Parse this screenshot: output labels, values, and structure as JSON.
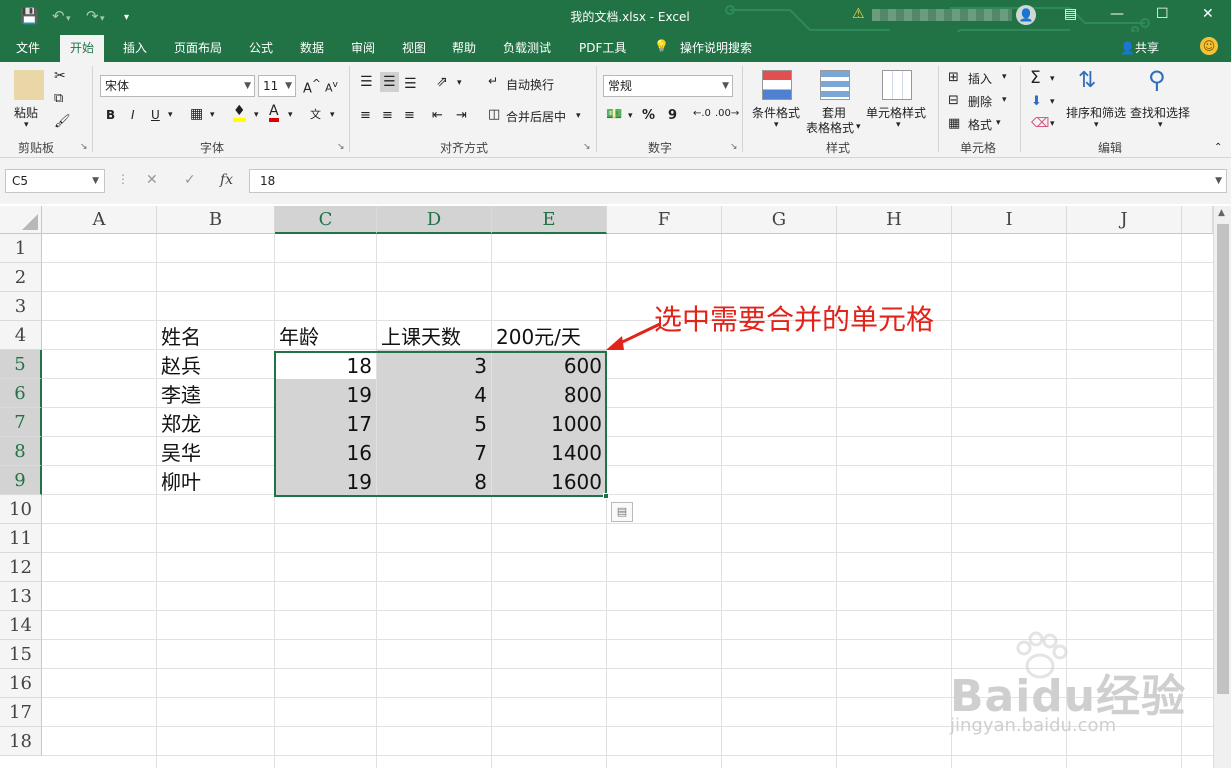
{
  "window": {
    "doc_title": "我的文档.xlsx  -  Excel",
    "user_avatar": "👤"
  },
  "tabs": [
    {
      "label": "文件"
    },
    {
      "label": "开始"
    },
    {
      "label": "插入"
    },
    {
      "label": "页面布局"
    },
    {
      "label": "公式"
    },
    {
      "label": "数据"
    },
    {
      "label": "审阅"
    },
    {
      "label": "视图"
    },
    {
      "label": "帮助"
    },
    {
      "label": "负载测试"
    },
    {
      "label": "PDF工具"
    },
    {
      "label": "操作说明搜索"
    }
  ],
  "share_label": "共享",
  "ribbon": {
    "clipboard": {
      "paste_label": "粘贴",
      "group_label": "剪贴板"
    },
    "font": {
      "font_name": "宋体",
      "font_size": "11",
      "group_label": "字体",
      "bold": "B",
      "italic": "I",
      "underline": "U"
    },
    "alignment": {
      "wrap_label": "自动换行",
      "merge_label": "合并后居中",
      "group_label": "对齐方式"
    },
    "number": {
      "format": "常规",
      "percent": "%",
      "comma": "9",
      "group_label": "数字"
    },
    "styles": {
      "cond_format": "条件格式",
      "table_format_1": "套用",
      "table_format_2": "表格格式",
      "cell_styles": "单元格样式",
      "group_label": "样式"
    },
    "cells": {
      "insert": "插入",
      "delete": "删除",
      "format": "格式",
      "group_label": "单元格"
    },
    "editing": {
      "sort_filter": "排序和筛选",
      "find_select": "查找和选择",
      "group_label": "编辑"
    }
  },
  "formula_bar": {
    "name_box": "C5",
    "formula": "18"
  },
  "columns": [
    "A",
    "B",
    "C",
    "D",
    "E",
    "F",
    "G",
    "H",
    "I",
    "J"
  ],
  "selected_columns": [
    "C",
    "D",
    "E"
  ],
  "rows": [
    "1",
    "2",
    "3",
    "4",
    "5",
    "6",
    "7",
    "8",
    "9",
    "10",
    "11",
    "12",
    "13",
    "14",
    "15",
    "16",
    "17",
    "18"
  ],
  "selected_rows": [
    "5",
    "6",
    "7",
    "8",
    "9"
  ],
  "table": {
    "headers": [
      "姓名",
      "年龄",
      "上课天数",
      "200元/天"
    ],
    "rows": [
      [
        "赵兵",
        "18",
        "3",
        "600"
      ],
      [
        "李逵",
        "19",
        "4",
        "800"
      ],
      [
        "郑龙",
        "17",
        "5",
        "1000"
      ],
      [
        "吴华",
        "16",
        "7",
        "1400"
      ],
      [
        "柳叶",
        "19",
        "8",
        "1600"
      ]
    ]
  },
  "annotation": "选中需要合并的单元格",
  "watermark": {
    "brand": "Baidu经验",
    "url": "jingyan.baidu.com"
  },
  "colors": {
    "accent": "#217346",
    "annotation": "#e2231a",
    "selection_fill": "#d4d4d4"
  }
}
